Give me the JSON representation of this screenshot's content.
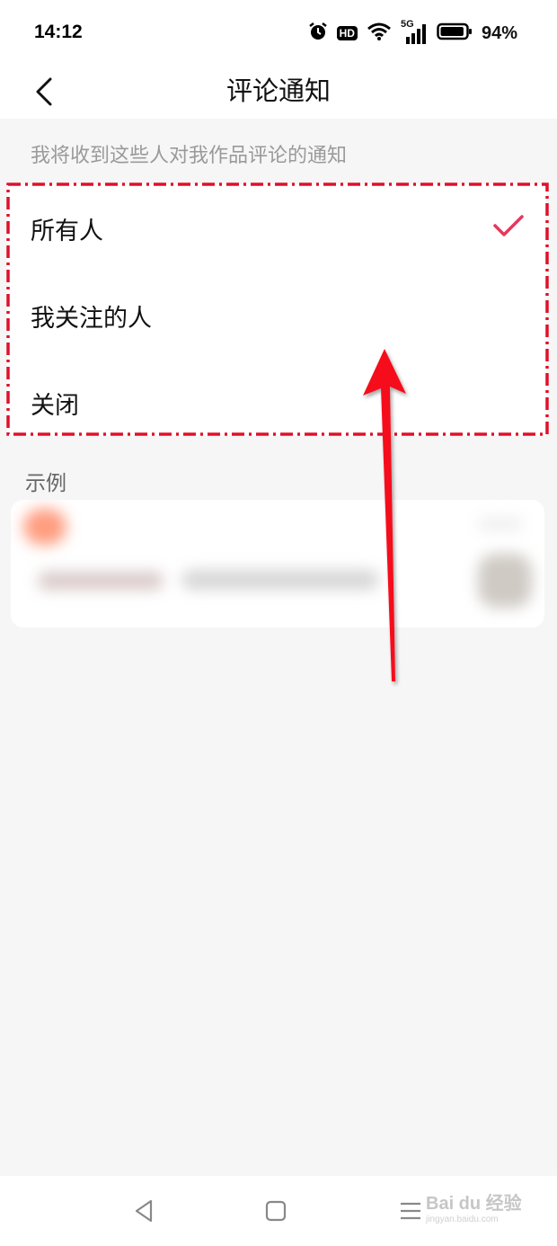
{
  "status_bar": {
    "time": "14:12",
    "hd_badge": "HD",
    "network_badge": "5G",
    "battery_percent": "94%",
    "battery_level": 0.94,
    "icons": [
      "alarm-icon",
      "hd-icon",
      "wifi-icon",
      "signal-icon",
      "battery-icon"
    ]
  },
  "header": {
    "title": "评论通知",
    "back_icon": "chevron-left-icon"
  },
  "notification": {
    "hint": "我将收到这些人对我作品评论的通知",
    "options": [
      {
        "label": "所有人",
        "selected": true
      },
      {
        "label": "我关注的人",
        "selected": false
      },
      {
        "label": "关闭",
        "selected": false
      }
    ],
    "check_color": "#e8365d"
  },
  "example": {
    "label": "示例"
  },
  "annotation": {
    "box_color": "#e0102a",
    "arrow_color": "#f5101c"
  },
  "nav_bar": {
    "icons": [
      "back-triangle-icon",
      "home-square-icon",
      "menu-lines-icon"
    ]
  },
  "watermark": {
    "text": "Bai du 经验",
    "subtext": "jingyan.baidu.com"
  }
}
